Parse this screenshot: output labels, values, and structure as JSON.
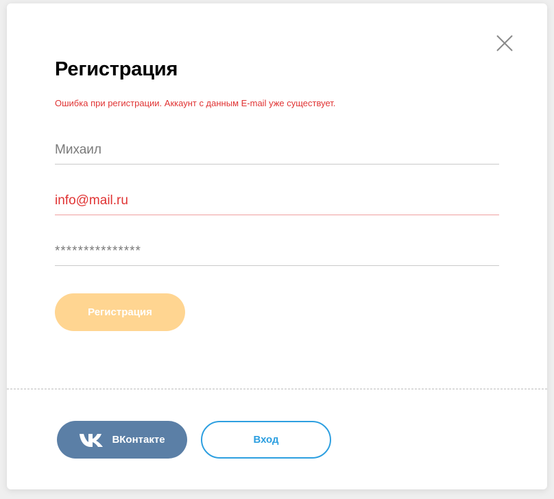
{
  "modal": {
    "title": "Регистрация",
    "error_message": "Ошибка при регистрации. Аккаунт с данным E-mail уже существует.",
    "close_icon": "close-icon"
  },
  "form": {
    "name_value": "Михаил",
    "email_value": "info@mail.ru",
    "password_value": "***************",
    "submit_label": "Регистрация"
  },
  "footer": {
    "vk_label": "ВКонтакте",
    "vk_icon": "vk-logo-icon",
    "login_label": "Вход"
  },
  "colors": {
    "error": "#e03333",
    "submit_disabled": "#ffd591",
    "vk": "#5b7fa6",
    "login_border": "#2d9fe0"
  }
}
